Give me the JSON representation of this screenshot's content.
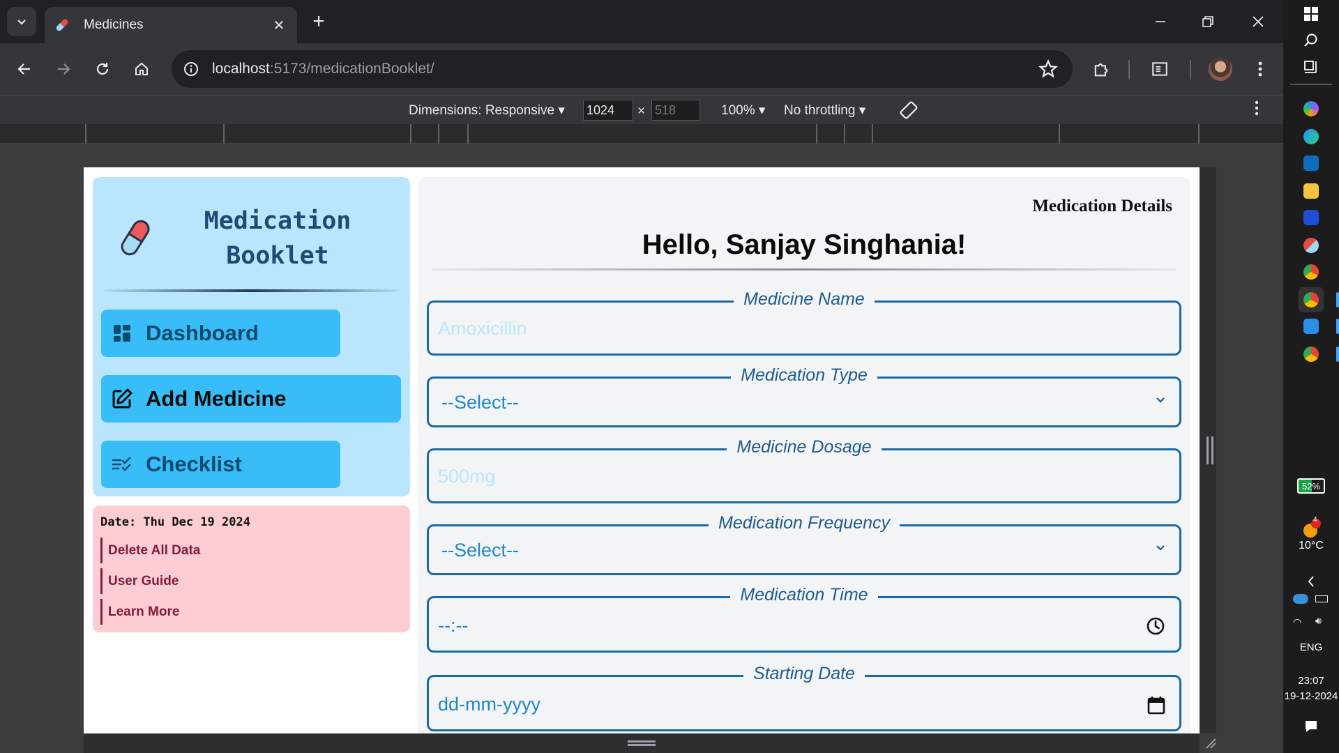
{
  "browser": {
    "tab_title": "Medicines",
    "url_host": "localhost",
    "url_rest": ":5173/medicationBooklet/",
    "devtools": {
      "dimensions_label": "Dimensions: Responsive",
      "width": "1024",
      "times": "×",
      "height_placeholder": "518",
      "zoom": "100%",
      "throttling": "No throttling"
    }
  },
  "sidebar": {
    "brand_line1": "Medication",
    "brand_line2": "Booklet",
    "nav": [
      {
        "label": "Dashboard",
        "icon": "dashboard-icon"
      },
      {
        "label": "Add Medicine",
        "icon": "edit-icon"
      },
      {
        "label": "Checklist",
        "icon": "checklist-icon"
      }
    ]
  },
  "info": {
    "date": "Date: Thu Dec 19 2024",
    "links": [
      "Delete All Data",
      "User Guide",
      "Learn More"
    ]
  },
  "main": {
    "section_title": "Medication Details",
    "greeting": "Hello, Sanjay Singhania!",
    "fields": {
      "medicine_name": {
        "label": "Medicine Name",
        "placeholder": "Amoxicillin"
      },
      "medication_type": {
        "label": "Medication Type",
        "value": "--Select--"
      },
      "medicine_dosage": {
        "label": "Medicine Dosage",
        "placeholder": "500mg"
      },
      "medication_frequency": {
        "label": "Medication Frequency",
        "value": "--Select--"
      },
      "medication_time": {
        "label": "Medication Time",
        "value": "--:--"
      },
      "starting_date": {
        "label": "Starting Date",
        "value": "dd-mm-yyyy"
      }
    }
  },
  "taskbar": {
    "battery": "52%",
    "weather_temp": "10°C",
    "weather_badge": "4",
    "language": "ENG",
    "time": "23:07",
    "date": "19-12-2024"
  },
  "colors": {
    "sidebar_bg": "#bae6fd",
    "nav_button": "#38bdf8",
    "info_bg": "#fecdd3",
    "field_border": "#1b6aa5",
    "main_bg": "#f3f4f6"
  }
}
